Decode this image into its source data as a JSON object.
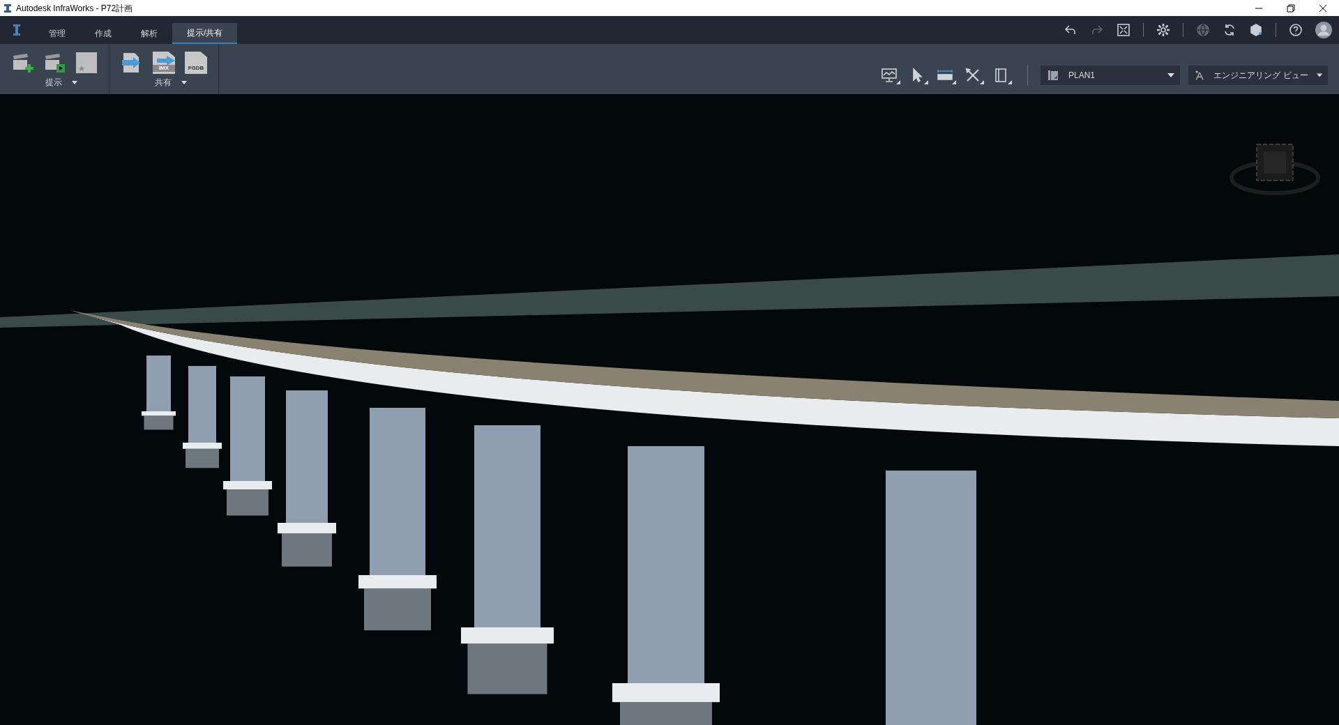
{
  "window": {
    "title": "Autodesk InfraWorks - P72計画"
  },
  "tabs": [
    {
      "label": "管理",
      "selected": false
    },
    {
      "label": "作成",
      "selected": false
    },
    {
      "label": "解析",
      "selected": false
    },
    {
      "label": "提示/共有",
      "selected": true
    }
  ],
  "ribbon_panels": [
    {
      "label": "提示",
      "tools": [
        {
          "kind": "clapper-add"
        },
        {
          "kind": "clapper-play"
        },
        {
          "kind": "star-tile"
        }
      ]
    },
    {
      "label": "共有",
      "tools": [
        {
          "kind": "export"
        },
        {
          "kind": "export-file",
          "badge": "IMX"
        },
        {
          "kind": "file",
          "badge": "FGDB"
        }
      ]
    }
  ],
  "quick_tools": [
    {
      "kind": "undo",
      "disabled": false
    },
    {
      "kind": "redo",
      "disabled": true
    },
    {
      "kind": "fit",
      "disabled": false
    },
    {
      "kind": "settings",
      "disabled": false
    },
    {
      "kind": "globe",
      "disabled": true
    },
    {
      "kind": "sync",
      "disabled": false
    },
    {
      "kind": "cube",
      "disabled": false
    },
    {
      "kind": "help",
      "disabled": false
    },
    {
      "kind": "avatar",
      "disabled": false
    }
  ],
  "view_tools": [
    {
      "kind": "monitor"
    },
    {
      "kind": "pointer"
    },
    {
      "kind": "ruler"
    },
    {
      "kind": "tools"
    },
    {
      "kind": "book"
    }
  ],
  "dropdowns": [
    {
      "kind": "proposal",
      "value": "PLAN1"
    },
    {
      "kind": "style",
      "value": "エンジニアリング ビュー"
    }
  ]
}
